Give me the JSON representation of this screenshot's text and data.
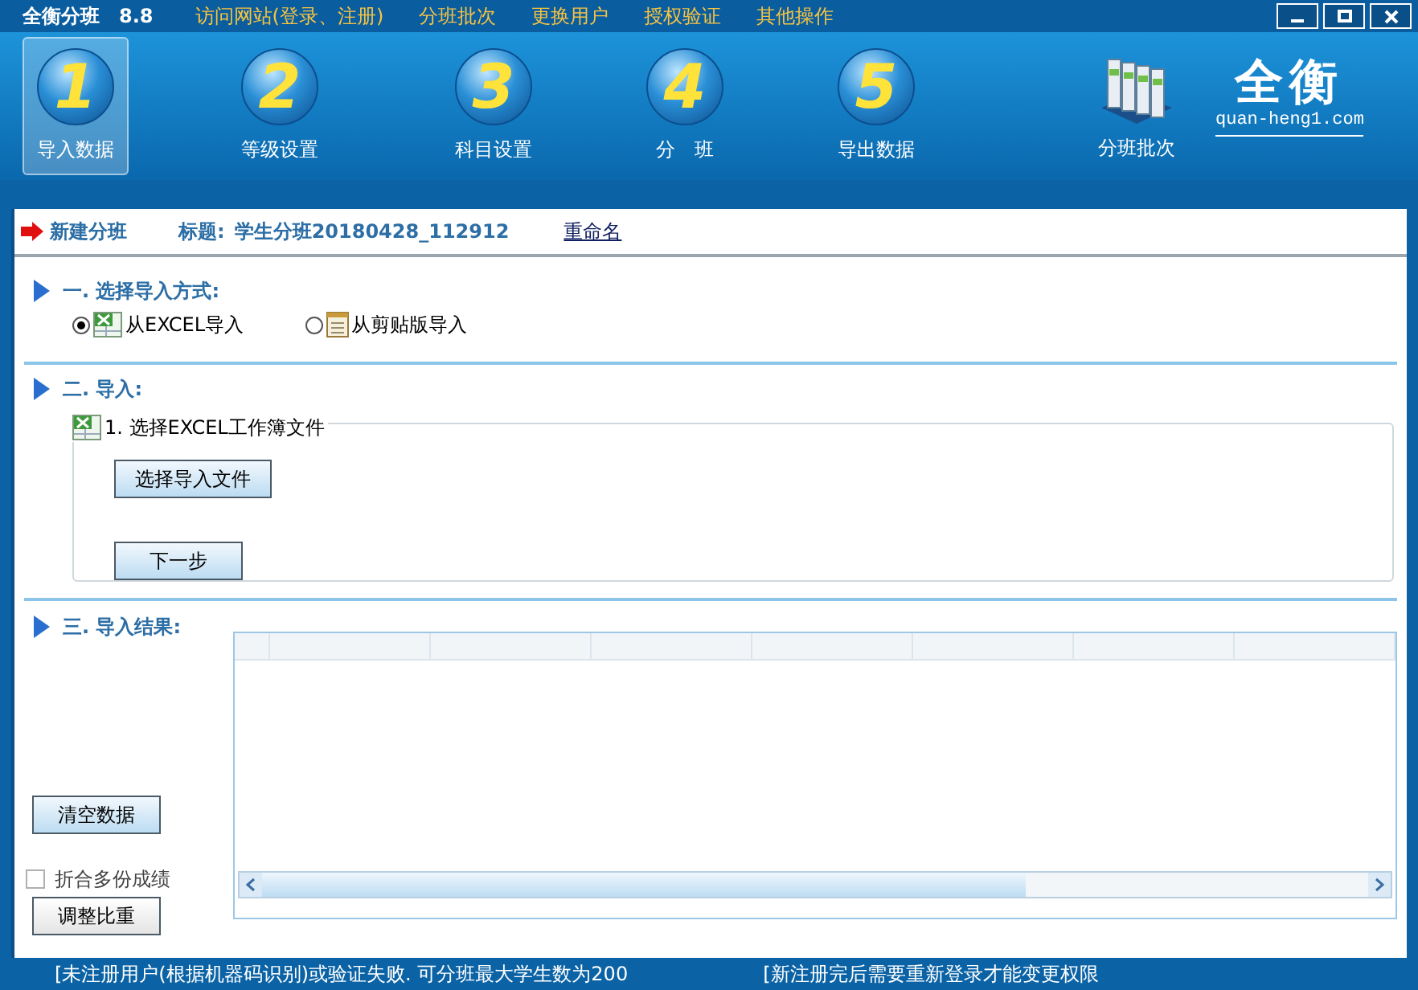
{
  "window": {
    "title": "全衡分班",
    "version": "8.8"
  },
  "menu": [
    "访问网站(登录、注册)",
    "分班批次",
    "更换用户",
    "授权验证",
    "其他操作"
  ],
  "toolbar": [
    {
      "number": "1",
      "label": "导入数据",
      "selected": true
    },
    {
      "number": "2",
      "label": "等级设置",
      "selected": false
    },
    {
      "number": "3",
      "label": "科目设置",
      "selected": false
    },
    {
      "number": "4",
      "label": "分　班",
      "selected": false
    },
    {
      "number": "5",
      "label": "导出数据",
      "selected": false
    }
  ],
  "batch_button": "分班批次",
  "logo": {
    "text": "全衡",
    "url": "quan-heng1.com"
  },
  "header": {
    "mode": "新建分班",
    "title_label": "标题:",
    "title": "学生分班20180428_112912",
    "rename": "重命名"
  },
  "section1": {
    "title": "一. 选择导入方式:",
    "options": [
      {
        "label": "从EXCEL导入",
        "kind": "excel",
        "selected": true
      },
      {
        "label": "从剪贴版导入",
        "kind": "clipboard",
        "selected": false
      }
    ]
  },
  "section2": {
    "title": "二. 导入:",
    "group": "1. 选择EXCEL工作簿文件",
    "choose_button": "选择导入文件",
    "next_button": "下一步"
  },
  "section3": {
    "title": "三. 导入结果:",
    "clear_button": "清空数据",
    "merge": {
      "label": "折合多份成绩",
      "checked": false
    },
    "weight_button": "调整比重"
  },
  "status_bar": [
    "[未注册用户(根据机器码识别)或验证失败. 可分班最大学生数为200",
    "[新注册完后需要重新登录才能变更权限"
  ]
}
